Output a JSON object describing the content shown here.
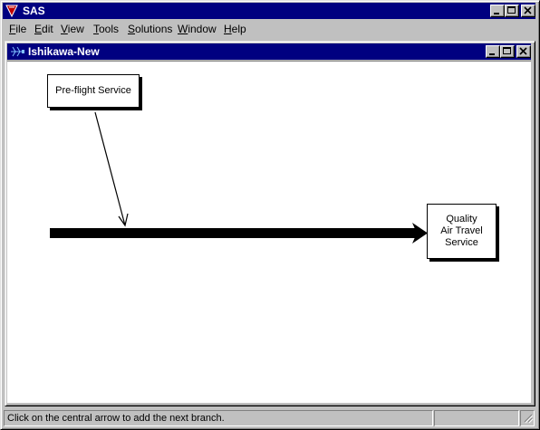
{
  "app": {
    "title": "SAS"
  },
  "menu": [
    {
      "label": "File",
      "accel": "F",
      "rest": "ile"
    },
    {
      "label": "Edit",
      "accel": "E",
      "rest": "dit"
    },
    {
      "label": "View",
      "accel": "V",
      "rest": "iew"
    },
    {
      "label": "Tools",
      "accel": "T",
      "rest": "ools"
    },
    {
      "label": "Solutions",
      "accel": "S",
      "rest": "olutions"
    },
    {
      "label": "Window",
      "accel": "W",
      "rest": "indow"
    },
    {
      "label": "Help",
      "accel": "H",
      "rest": "elp"
    }
  ],
  "document": {
    "title": "Ishikawa-New",
    "diagram": {
      "branch_label": "Pre-flight Service",
      "effect_label": "Quality\nAir Travel\nService"
    }
  },
  "status": {
    "message": "Click on the central arrow to add the next branch."
  },
  "icons": {
    "app": "sas-icon",
    "document": "ishikawa-icon",
    "minimize": "minimize-icon",
    "maximize": "maximize-icon",
    "close": "close-icon"
  }
}
